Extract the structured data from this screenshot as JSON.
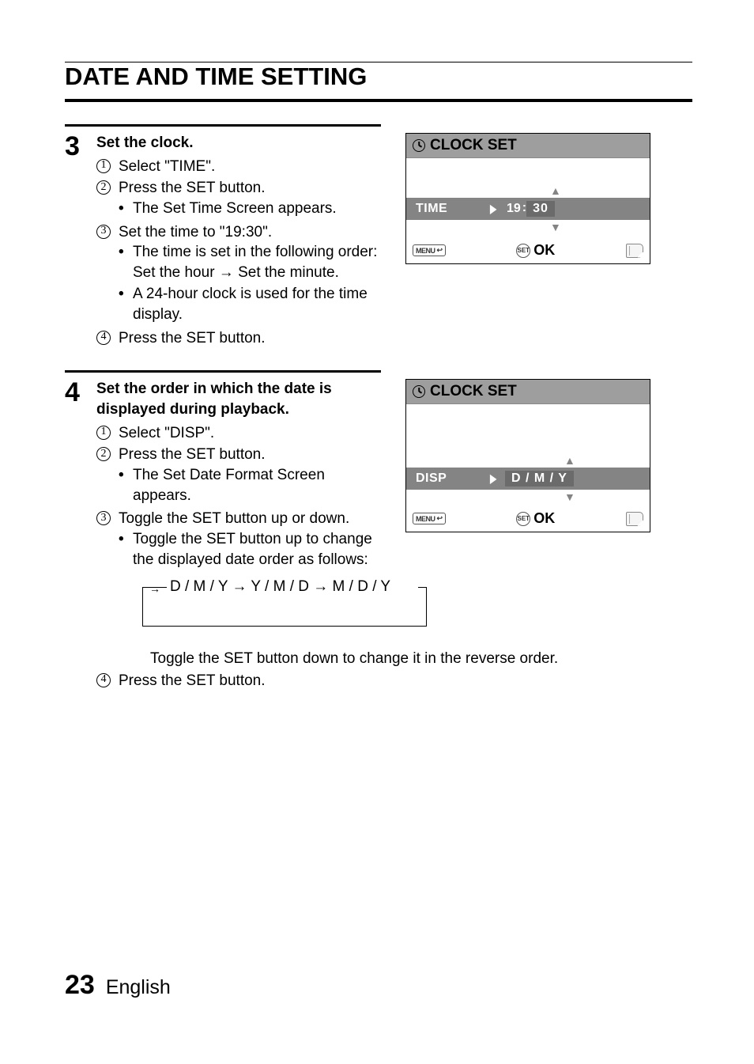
{
  "title": "DATE AND TIME SETTING",
  "step3": {
    "number": "3",
    "lead": "Set the clock.",
    "items": {
      "i1": "Select \"TIME\".",
      "i2": "Press the SET button.",
      "i2_b1": "The Set Time Screen appears.",
      "i3": "Set the time to \"19:30\".",
      "i3_b1": "The time is set in the following order: Set the hour → Set the minute.",
      "i3_b2": "A 24-hour clock is used for the time display.",
      "i4": "Press the SET button."
    }
  },
  "step4": {
    "number": "4",
    "lead": "Set the order in which the date is displayed during playback.",
    "items": {
      "i1": "Select \"DISP\".",
      "i2": "Press the SET button.",
      "i2_b1": "The Set Date Format Screen appears.",
      "i3": "Toggle the SET button up or down.",
      "i3_b1": "Toggle the SET button up to change the displayed date order as follows:"
    },
    "cycle": "D / M / Y → Y / M / D → M / D / Y",
    "after_text": "Toggle the SET button down to change it in the reverse order.",
    "i4": "Press the SET button."
  },
  "lcd1": {
    "header": "CLOCK SET",
    "label": "TIME",
    "value_hour": "19",
    "value_min": "30",
    "ok": "OK",
    "menu": "MENU",
    "set": "SET"
  },
  "lcd2": {
    "header": "CLOCK SET",
    "label": "DISP",
    "value": "D / M / Y",
    "ok": "OK",
    "menu": "MENU",
    "set": "SET"
  },
  "footer": {
    "page": "23",
    "lang": "English"
  },
  "substep_nums": {
    "n1": "1",
    "n2": "2",
    "n3": "3",
    "n4": "4"
  }
}
